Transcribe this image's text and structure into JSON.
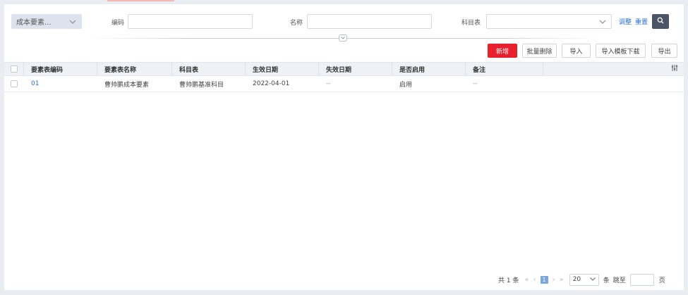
{
  "filters": {
    "category": "成本要素...",
    "code_label": "编码",
    "code_value": "",
    "name_label": "名称",
    "name_value": "",
    "subject_label": "科目表",
    "subject_value": "",
    "adjust_link": "调整",
    "reset_link": "重置"
  },
  "actions": {
    "add": "新增",
    "batch_delete": "批量删除",
    "import": "导入",
    "import_template": "导入模板下载",
    "export": "导出"
  },
  "table": {
    "columns": [
      "要素表编码",
      "要素表名称",
      "科目表",
      "生效日期",
      "失效日期",
      "是否启用",
      "备注"
    ],
    "rows": [
      {
        "code": "01",
        "name": "曹帅鹏成本要素",
        "subject": "曹帅鹏基准科目",
        "start": "2022-04-01",
        "end": "--",
        "enabled": "启用",
        "remark": "--"
      }
    ]
  },
  "pagination": {
    "total": "共 1 条",
    "current_page": "1",
    "page_size": "20",
    "per_page_unit": "条",
    "jump_label": "跳至",
    "page_unit": "页"
  },
  "colors": {
    "primary": "#e8202e",
    "link": "#2a6fd6",
    "search_button": "#4a5566"
  }
}
